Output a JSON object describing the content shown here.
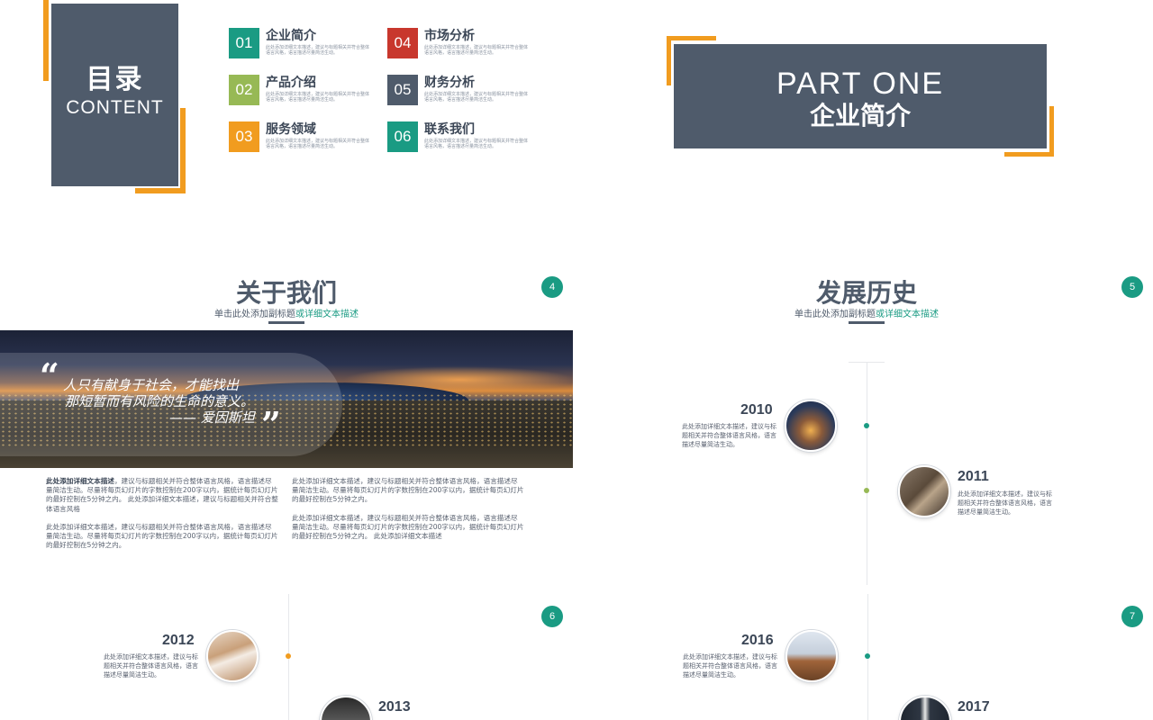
{
  "toc": {
    "title_cn": "目录",
    "title_en": "CONTENT",
    "items": [
      {
        "num": "01",
        "label": "企业简介",
        "desc": "此处添加详细文本描述，建议与标题相关并符合整体语言风格，语言描述尽量简洁生动。",
        "color": "#1a9b83"
      },
      {
        "num": "02",
        "label": "产品介绍",
        "desc": "此处添加详细文本描述，建议与标题相关并符合整体语言风格，语言描述尽量简洁生动。",
        "color": "#97b955"
      },
      {
        "num": "03",
        "label": "服务领域",
        "desc": "此处添加详细文本描述，建议与标题相关并符合整体语言风格，语言描述尽量简洁生动。",
        "color": "#f19c1f"
      },
      {
        "num": "04",
        "label": "市场分析",
        "desc": "此处添加详细文本描述，建议与标题相关并符合整体语言风格，语言描述尽量简洁生动。",
        "color": "#c8372d"
      },
      {
        "num": "05",
        "label": "财务分析",
        "desc": "此处添加详细文本描述，建议与标题相关并符合整体语言风格，语言描述尽量简洁生动。",
        "color": "#4f5b6b"
      },
      {
        "num": "06",
        "label": "联系我们",
        "desc": "此处添加详细文本描述，建议与标题相关并符合整体语言风格，语言描述尽量简洁生动。",
        "color": "#1a9b83"
      }
    ]
  },
  "part_one": {
    "line1": "PART ONE",
    "line2": "企业简介"
  },
  "about": {
    "title": "关于我们",
    "subtitle_a": "单击此处添加副标题",
    "subtitle_b": "或详细文本描述",
    "page": "4",
    "quote_line1": "人只有献身于社会，才能找出",
    "quote_line2": "那短暂而有风险的生命的意义。",
    "quote_line3": "—— 爱因斯坦",
    "quote_open": "“",
    "quote_close": "”",
    "p1_bold": "此处添加详细文本描述",
    "p1_rest": "，建议与标题相关并符合整体语言风格，语言描述尽量简洁生动。尽量将每页幻灯片的字数控制在200字以内，据统计每页幻灯片的最好控制在5分钟之内。 此处添加详细文本描述，建议与标题相关并符合整体语言风格",
    "p2": "此处添加详细文本描述，建议与标题相关并符合整体语言风格，语言描述尽量简洁生动。尽量将每页幻灯片的字数控制在200字以内，据统计每页幻灯片的最好控制在5分钟之内。",
    "p3": "此处添加详细文本描述，建议与标题相关并符合整体语言风格，语言描述尽量简洁生动。尽量将每页幻灯片的字数控制在200字以内，据统计每页幻灯片的最好控制在5分钟之内。",
    "p4": "此处添加详细文本描述，建议与标题相关并符合整体语言风格，语言描述尽量简洁生动。尽量将每页幻灯片的字数控制在200字以内，据统计每页幻灯片的最好控制在5分钟之内。 此处添加详细文本描述"
  },
  "history": {
    "title": "发展历史",
    "subtitle_a": "单击此处添加副标题",
    "subtitle_b": "或详细文本描述",
    "page": "5",
    "entries": [
      {
        "year": "2010",
        "desc": "此处添加详细文本描述，建议与标题相关并符合整体语言风格，语言描述尽量简洁生动。"
      },
      {
        "year": "2011",
        "desc": "此处添加详细文本描述，建议与标题相关并符合整体语言风格，语言描述尽量简洁生动。"
      }
    ]
  },
  "slide6": {
    "page": "6",
    "entries": [
      {
        "year": "2012",
        "desc": "此处添加详细文本描述，建议与标题相关并符合整体语言风格，语言描述尽量简洁生动。"
      },
      {
        "year": "2013"
      }
    ]
  },
  "slide7": {
    "page": "7",
    "entries": [
      {
        "year": "2016",
        "desc": "此处添加详细文本描述，建议与标题相关并符合整体语言风格，语言描述尽量简洁生动。"
      },
      {
        "year": "2017"
      }
    ]
  },
  "colors": {
    "slate": "#4f5b6b",
    "orange": "#f19c1f",
    "teal": "#1a9b83",
    "green": "#97b955",
    "red": "#c8372d"
  }
}
